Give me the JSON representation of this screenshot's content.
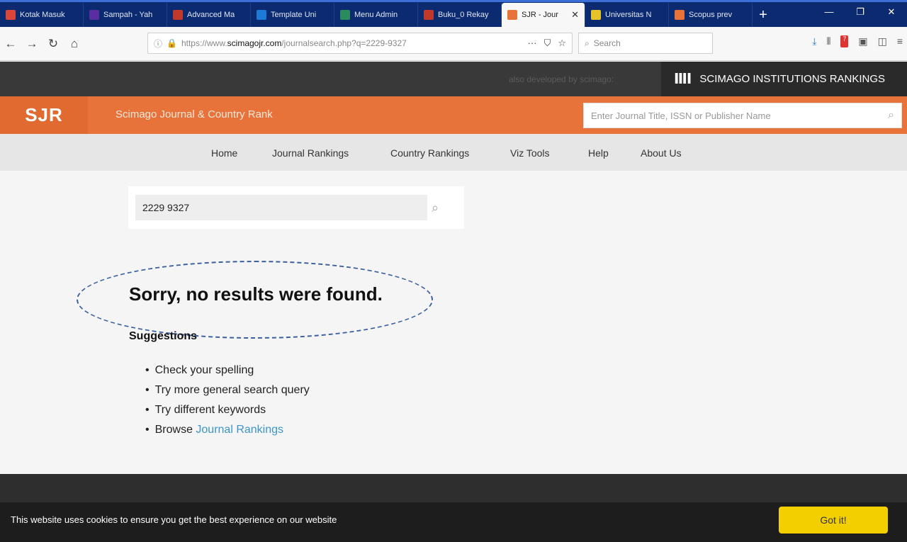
{
  "browser": {
    "tabs": [
      {
        "label": "Kotak Masuk",
        "color": "#d9463b"
      },
      {
        "label": "Sampah - Yah",
        "color": "#5a2da0"
      },
      {
        "label": "Advanced Ma",
        "color": "#c0392b"
      },
      {
        "label": "Template Uni",
        "color": "#1e7ad7"
      },
      {
        "label": "Menu Admin",
        "color": "#2a8b5f"
      },
      {
        "label": "Buku_0 Rekay",
        "color": "#c0392b"
      },
      {
        "label": "SJR - Jour",
        "color": "#e8733a",
        "active": true
      },
      {
        "label": "Universitas N",
        "color": "#e7c32b"
      },
      {
        "label": "Scopus prev",
        "color": "#e8733a"
      }
    ],
    "url_prefix": "https://www.",
    "url_host": "scimagojr.com",
    "url_path": "/journalsearch.php?q=2229-9327",
    "search_placeholder": "Search"
  },
  "topbar": {
    "also": "also developed by scimago:",
    "sir_label": "SCIMAGO INSTITUTIONS RANKINGS"
  },
  "header": {
    "logo": "SJR",
    "site_name": "Scimago Journal & Country Rank",
    "search_placeholder": "Enter Journal Title, ISSN or Publisher Name"
  },
  "menu": [
    "Home",
    "Journal Rankings",
    "Country Rankings",
    "Viz Tools",
    "Help",
    "About Us"
  ],
  "search": {
    "value": "2229 9327"
  },
  "results": {
    "message": "Sorry, no results were found.",
    "suggestions_title": "Suggestions",
    "suggestions": [
      "Check your spelling",
      "Try more general search query",
      "Try different keywords"
    ],
    "browse_prefix": "Browse ",
    "browse_link": "Journal Rankings"
  },
  "cookie": {
    "message": "This website uses cookies to ensure you get the best experience on our website",
    "button": "Got it!"
  }
}
